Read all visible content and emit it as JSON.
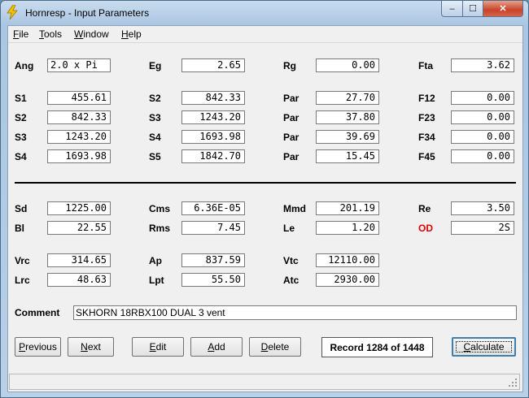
{
  "window": {
    "title": "Hornresp - Input Parameters",
    "controls": {
      "minimize": "–",
      "maximize": "☐",
      "close": "✕"
    }
  },
  "menu": [
    {
      "underline": "F",
      "rest": "ile"
    },
    {
      "underline": "T",
      "rest": "ools"
    },
    {
      "underline": "W",
      "rest": "indow"
    },
    {
      "underline": "H",
      "rest": "elp"
    }
  ],
  "params": {
    "row0": [
      {
        "label": "Ang",
        "value": "2.0 x Pi"
      },
      {
        "label": "Eg",
        "value": "2.65"
      },
      {
        "label": "Rg",
        "value": "0.00"
      },
      {
        "label": "Fta",
        "value": "3.62"
      }
    ],
    "row1": [
      {
        "label": "S1",
        "value": "455.61"
      },
      {
        "label": "S2",
        "value": "842.33"
      },
      {
        "label": "Par",
        "value": "27.70"
      },
      {
        "label": "F12",
        "value": "0.00"
      }
    ],
    "row2": [
      {
        "label": "S2",
        "value": "842.33"
      },
      {
        "label": "S3",
        "value": "1243.20"
      },
      {
        "label": "Par",
        "value": "37.80"
      },
      {
        "label": "F23",
        "value": "0.00"
      }
    ],
    "row3": [
      {
        "label": "S3",
        "value": "1243.20"
      },
      {
        "label": "S4",
        "value": "1693.98"
      },
      {
        "label": "Par",
        "value": "39.69"
      },
      {
        "label": "F34",
        "value": "0.00"
      }
    ],
    "row4": [
      {
        "label": "S4",
        "value": "1693.98"
      },
      {
        "label": "S5",
        "value": "1842.70"
      },
      {
        "label": "Par",
        "value": "15.45"
      },
      {
        "label": "F45",
        "value": "0.00"
      }
    ],
    "row5": [
      {
        "label": "Sd",
        "value": "1225.00"
      },
      {
        "label": "Cms",
        "value": "6.36E-05"
      },
      {
        "label": "Mmd",
        "value": "201.19"
      },
      {
        "label": "Re",
        "value": "3.50"
      }
    ],
    "row6": [
      {
        "label": "Bl",
        "value": "22.55"
      },
      {
        "label": "Rms",
        "value": "7.45"
      },
      {
        "label": "Le",
        "value": "1.20"
      },
      {
        "label": "OD",
        "value": "2S"
      }
    ],
    "row7": [
      {
        "label": "Vrc",
        "value": "314.65"
      },
      {
        "label": "Ap",
        "value": "837.59"
      },
      {
        "label": "Vtc",
        "value": "12110.00"
      }
    ],
    "row8": [
      {
        "label": "Lrc",
        "value": "48.63"
      },
      {
        "label": "Lpt",
        "value": "55.50"
      },
      {
        "label": "Atc",
        "value": "2930.00"
      }
    ]
  },
  "comment": {
    "label": "Comment",
    "value": "SKHORN 18RBX100 DUAL 3 vent"
  },
  "buttons": {
    "previous": {
      "underline": "P",
      "rest": "revious"
    },
    "next": {
      "underline": "N",
      "rest": "ext"
    },
    "edit": {
      "underline": "E",
      "rest": "dit"
    },
    "add": {
      "underline": "A",
      "rest": "dd"
    },
    "delete": {
      "underline": "D",
      "rest": "elete"
    },
    "calculate": {
      "underline": "C",
      "rest": "alculate"
    }
  },
  "record": "Record 1284 of 1448",
  "colors": {
    "od_label": "#e00000",
    "title_bar": "#b8d0e8",
    "close_button": "#c7432b"
  }
}
